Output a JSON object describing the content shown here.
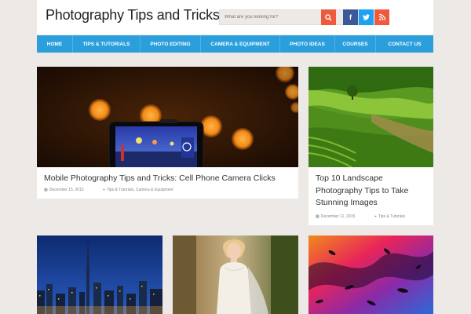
{
  "header": {
    "site_title": "Photography Tips and Tricks",
    "search_placeholder": "What are you looking for?",
    "social": {
      "facebook": "f",
      "twitter": "t",
      "rss": "rss"
    }
  },
  "nav": {
    "items": [
      "HOME",
      "TIPS & TUTORIALS",
      "PHOTO EDITING",
      "CAMERA & EQUIPMENT",
      "PHOTO IDEAS",
      "COURSES",
      "CONTACT US"
    ]
  },
  "posts": [
    {
      "title": "Mobile Photography Tips and Tricks: Cell Phone Camera Clicks",
      "date": "December 15, 2015",
      "categories": "Tips & Tutorials, Camera & Equipment"
    },
    {
      "title": "Top 10 Landscape Photography Tips to Take Stunning Images",
      "date": "December 11, 2015",
      "categories": "Tips & Tutorials"
    }
  ],
  "colors": {
    "accent_blue": "#2a9fdc",
    "accent_orange": "#ee5a3c",
    "background": "#ece9e6"
  }
}
